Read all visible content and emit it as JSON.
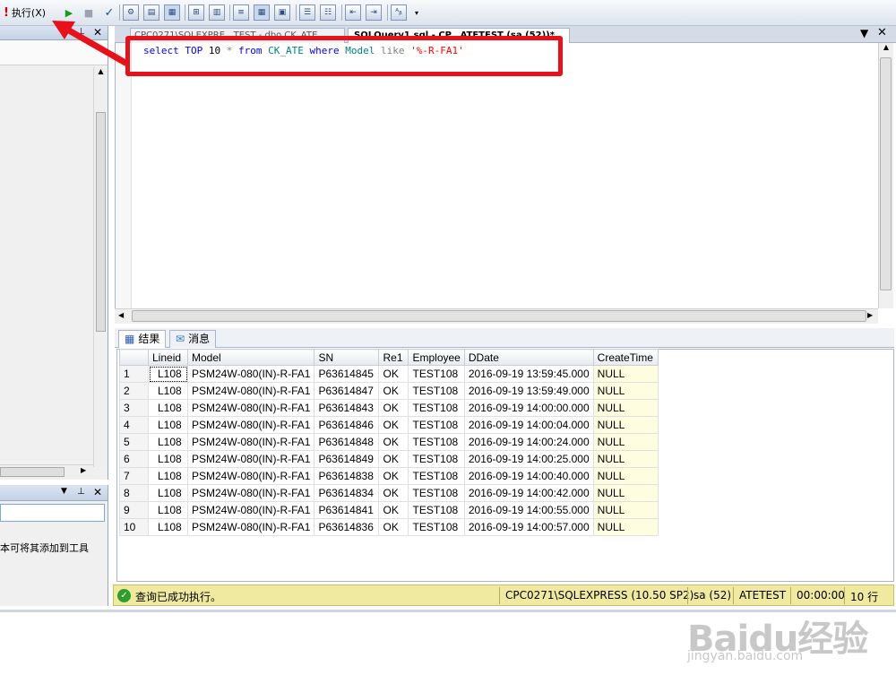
{
  "toolbar": {
    "execute_label": "执行(X)"
  },
  "left_panel": {
    "bottom_text": "本可将其添加到工具"
  },
  "editor": {
    "tab1_label": "CPC0271\\SQLEXPRE...TEST - dbo.CK_ATE",
    "tab2_label": "SQLQuery1.sql - CP...ATETEST (sa (52))*",
    "sql": {
      "kw_select": "select",
      "kw_top": "TOP",
      "num": "10",
      "star": "*",
      "kw_from": "from",
      "table": "CK_ATE",
      "kw_where": "where",
      "column": "Model",
      "kw_like": "like",
      "pattern": "'%-R-FA1'"
    }
  },
  "results_tabs": {
    "results": "结果",
    "messages": "消息"
  },
  "grid": {
    "columns": [
      "",
      "Lineid",
      "Model",
      "SN",
      "Re1",
      "Employee",
      "DDate",
      "CreateTime"
    ],
    "rows": [
      [
        "1",
        "L108",
        "PSM24W-080(IN)-R-FA1",
        "P63614845",
        "OK",
        "TEST108",
        "2016-09-19 13:59:45.000",
        "NULL"
      ],
      [
        "2",
        "L108",
        "PSM24W-080(IN)-R-FA1",
        "P63614847",
        "OK",
        "TEST108",
        "2016-09-19 13:59:49.000",
        "NULL"
      ],
      [
        "3",
        "L108",
        "PSM24W-080(IN)-R-FA1",
        "P63614843",
        "OK",
        "TEST108",
        "2016-09-19 14:00:00.000",
        "NULL"
      ],
      [
        "4",
        "L108",
        "PSM24W-080(IN)-R-FA1",
        "P63614846",
        "OK",
        "TEST108",
        "2016-09-19 14:00:04.000",
        "NULL"
      ],
      [
        "5",
        "L108",
        "PSM24W-080(IN)-R-FA1",
        "P63614848",
        "OK",
        "TEST108",
        "2016-09-19 14:00:24.000",
        "NULL"
      ],
      [
        "6",
        "L108",
        "PSM24W-080(IN)-R-FA1",
        "P63614849",
        "OK",
        "TEST108",
        "2016-09-19 14:00:25.000",
        "NULL"
      ],
      [
        "7",
        "L108",
        "PSM24W-080(IN)-R-FA1",
        "P63614838",
        "OK",
        "TEST108",
        "2016-09-19 14:00:40.000",
        "NULL"
      ],
      [
        "8",
        "L108",
        "PSM24W-080(IN)-R-FA1",
        "P63614834",
        "OK",
        "TEST108",
        "2016-09-19 14:00:42.000",
        "NULL"
      ],
      [
        "9",
        "L108",
        "PSM24W-080(IN)-R-FA1",
        "P63614841",
        "OK",
        "TEST108",
        "2016-09-19 14:00:55.000",
        "NULL"
      ],
      [
        "10",
        "L108",
        "PSM24W-080(IN)-R-FA1",
        "P63614836",
        "OK",
        "TEST108",
        "2016-09-19 14:00:57.000",
        "NULL"
      ]
    ]
  },
  "status": {
    "message": "查询已成功执行。",
    "server": "CPC0271\\SQLEXPRESS (10.50 SP2)",
    "user": "sa (52)",
    "database": "ATETEST",
    "time": "00:00:00",
    "rows": "10 行"
  },
  "watermark": {
    "main": "Baidu经验",
    "sub": "jingyan.baidu.com"
  },
  "colors": {
    "highlight_border": "#e8111a",
    "keyword": "#0000ff",
    "object": "#008080",
    "string": "#ff0000",
    "status_bg": "#f0eaa0"
  }
}
